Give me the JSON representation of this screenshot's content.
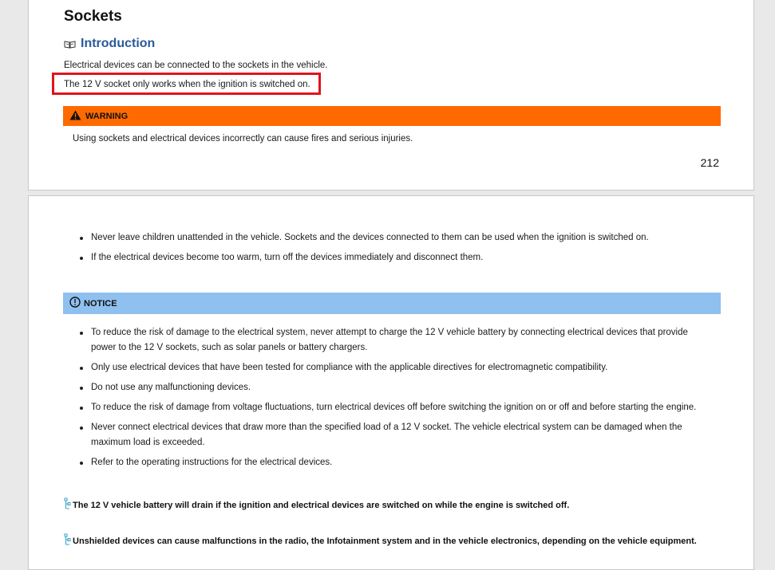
{
  "page1": {
    "heading": "Sockets",
    "subheading": "Introduction",
    "para1": "Electrical devices can be connected to the sockets in the vehicle.",
    "para2": "The 12 V socket only works when the ignition is switched on.",
    "warning_label": "WARNING",
    "warning_text": "Using sockets and electrical devices incorrectly can cause fires and serious injuries.",
    "page_number": "212"
  },
  "page2": {
    "warning_bullets": [
      "Never leave children unattended in the vehicle. Sockets and the devices connected to them can be used when the ignition is switched on.",
      "If the electrical devices become too warm, turn off the devices immediately and disconnect them."
    ],
    "notice_label": "NOTICE",
    "notice_bullets": [
      "To reduce the risk of damage to the electrical system, never attempt to charge the 12 V vehicle battery by connecting electrical devices that provide power to the 12 V sockets, such as solar panels or battery chargers.",
      "Only use electrical devices that have been tested for compliance with the applicable directives for electromagnetic compatibility.",
      "Do not use any malfunctioning devices.",
      "To reduce the risk of damage from voltage fluctuations, turn electrical devices off before switching the ignition on or off and before starting the engine.",
      "Never connect electrical devices that draw more than the specified load of a 12 V socket. The vehicle electrical system can be damaged when the maximum load is exceeded.",
      "Refer to the operating instructions for the electrical devices."
    ],
    "note1": "The 12 V vehicle battery will drain if the ignition and electrical devices are switched on while the engine is switched off.",
    "note2": "Unshielded devices can cause malfunctions in the radio, the Infotainment system and in the vehicle electronics, depending on the vehicle equipment."
  },
  "colors": {
    "warning": "#ff6a00",
    "notice": "#8fc0f0",
    "highlight": "#e0141c",
    "subheading": "#2a5a9a",
    "env_icon": "#3aa0c8"
  },
  "icons": {
    "intro": "book-icon",
    "warning": "warning-triangle-icon",
    "notice": "notice-circle-icon",
    "note": "environment-note-icon"
  }
}
